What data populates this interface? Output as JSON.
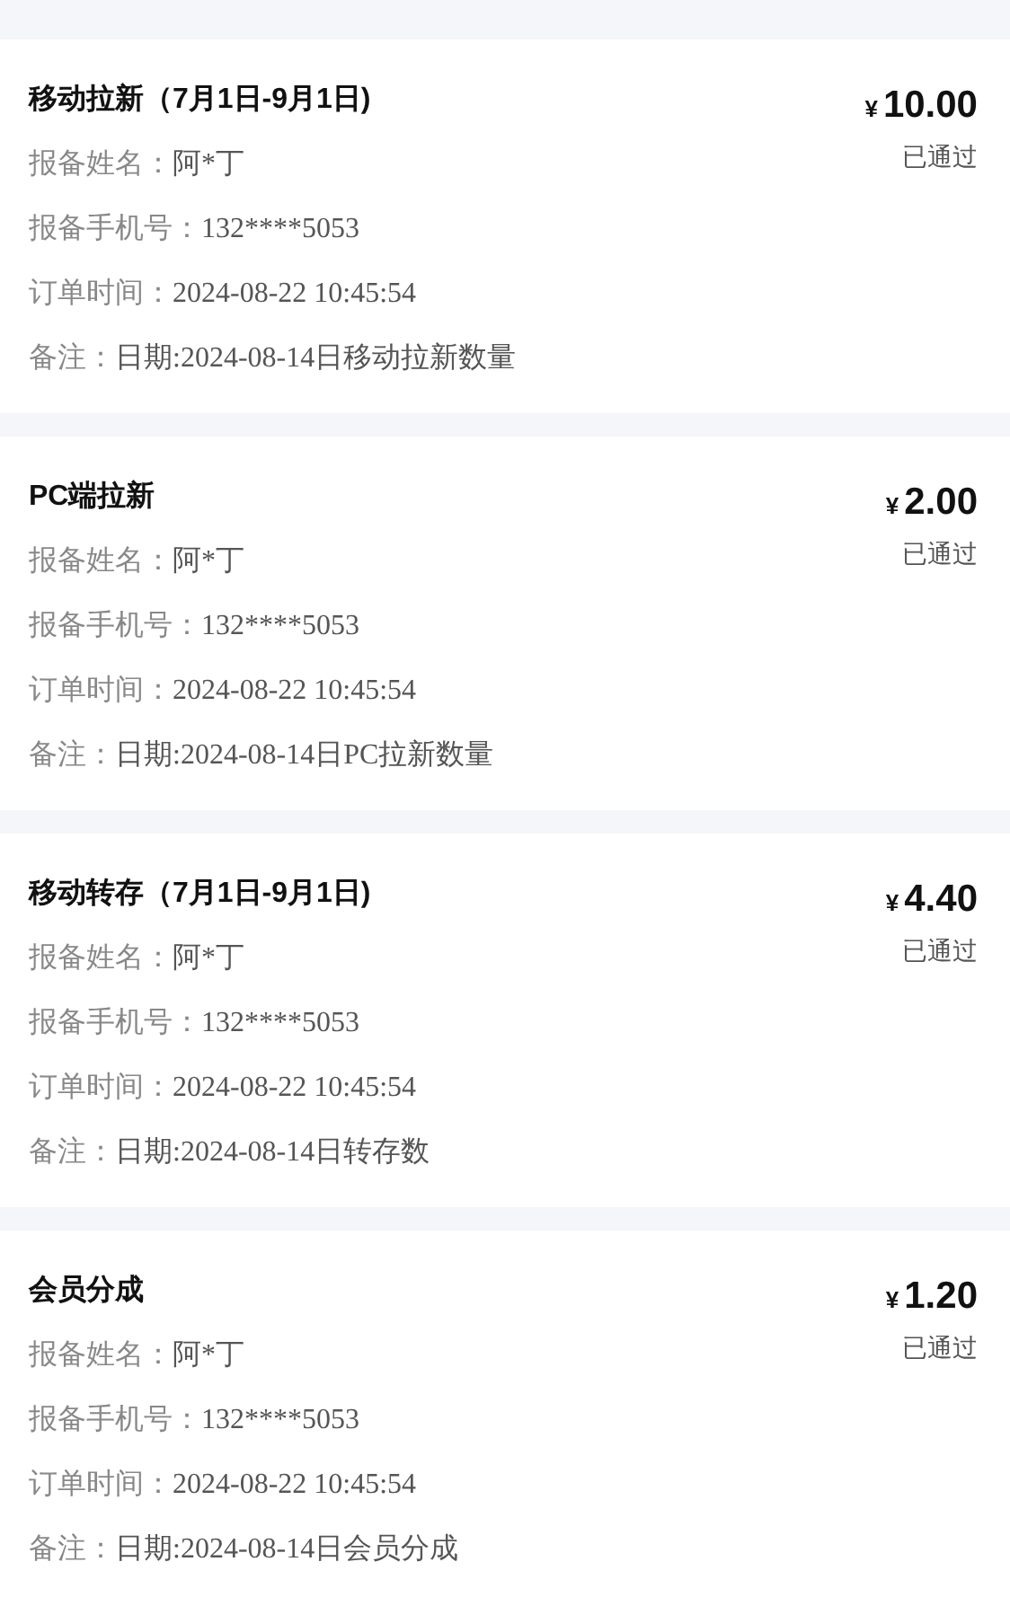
{
  "orders": [
    {
      "title": "移动拉新（7月1日-9月1日)",
      "currency": "¥",
      "amount": "10.00",
      "status": "已通过",
      "fields": [
        {
          "label": "报备姓名：",
          "value": "阿*丁"
        },
        {
          "label": "报备手机号：",
          "value": "132****5053"
        },
        {
          "label": "订单时间：",
          "value": "2024-08-22 10:45:54"
        },
        {
          "label": "备注：",
          "value": "日期:2024-08-14日移动拉新数量"
        }
      ]
    },
    {
      "title": "PC端拉新",
      "currency": "¥",
      "amount": "2.00",
      "status": "已通过",
      "fields": [
        {
          "label": "报备姓名：",
          "value": "阿*丁"
        },
        {
          "label": "报备手机号：",
          "value": "132****5053"
        },
        {
          "label": "订单时间：",
          "value": "2024-08-22 10:45:54"
        },
        {
          "label": "备注：",
          "value": "日期:2024-08-14日PC拉新数量"
        }
      ]
    },
    {
      "title": "移动转存（7月1日-9月1日)",
      "currency": "¥",
      "amount": "4.40",
      "status": "已通过",
      "fields": [
        {
          "label": "报备姓名：",
          "value": "阿*丁"
        },
        {
          "label": "报备手机号：",
          "value": "132****5053"
        },
        {
          "label": "订单时间：",
          "value": "2024-08-22 10:45:54"
        },
        {
          "label": "备注：",
          "value": "日期:2024-08-14日转存数"
        }
      ]
    },
    {
      "title": "会员分成",
      "currency": "¥",
      "amount": "1.20",
      "status": "已通过",
      "fields": [
        {
          "label": "报备姓名：",
          "value": "阿*丁"
        },
        {
          "label": "报备手机号：",
          "value": "132****5053"
        },
        {
          "label": "订单时间：",
          "value": "2024-08-22 10:45:54"
        },
        {
          "label": "备注：",
          "value": "日期:2024-08-14日会员分成"
        }
      ]
    }
  ]
}
